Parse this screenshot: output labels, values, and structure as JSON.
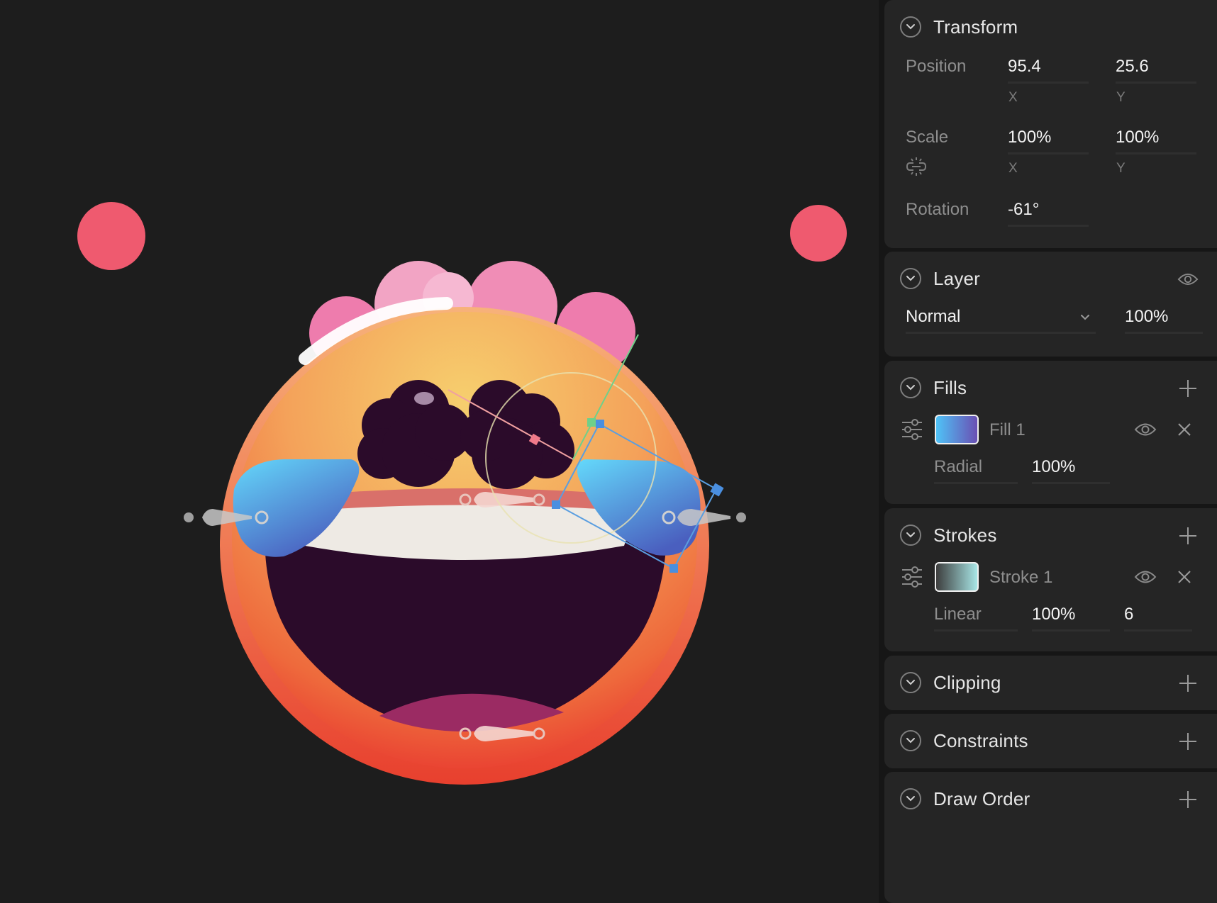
{
  "transform": {
    "title": "Transform",
    "position_label": "Position",
    "position_x": "95.4",
    "position_y": "25.6",
    "x_label": "X",
    "y_label": "Y",
    "scale_label": "Scale",
    "scale_x": "100%",
    "scale_y": "100%",
    "rotation_label": "Rotation",
    "rotation": "-61°"
  },
  "layer": {
    "title": "Layer",
    "blend_mode": "Normal",
    "opacity": "100%"
  },
  "fills": {
    "title": "Fills",
    "items": [
      {
        "name": "Fill 1",
        "type": "Radial",
        "opacity": "100%"
      }
    ]
  },
  "strokes": {
    "title": "Strokes",
    "items": [
      {
        "name": "Stroke 1",
        "type": "Linear",
        "opacity": "100%",
        "width": "6"
      }
    ]
  },
  "clipping": {
    "title": "Clipping"
  },
  "constraints": {
    "title": "Constraints"
  },
  "draw_order": {
    "title": "Draw Order"
  },
  "colors": {
    "canvas_bg": "#1d1d1d",
    "panel_bg": "#252525",
    "accent_pink": "#ef5a6f",
    "fill_gradient_start": "#4fc3f7",
    "fill_gradient_end": "#6a4fb3",
    "stroke_gradient_start": "#3d3d3d",
    "stroke_gradient_end": "#a8e6e6"
  },
  "icons": {
    "collapse": "chevron-down-icon",
    "visibility": "eye-icon",
    "add": "plus-icon",
    "remove": "close-icon",
    "adjust": "sliders-icon",
    "link": "unlink-icon"
  }
}
